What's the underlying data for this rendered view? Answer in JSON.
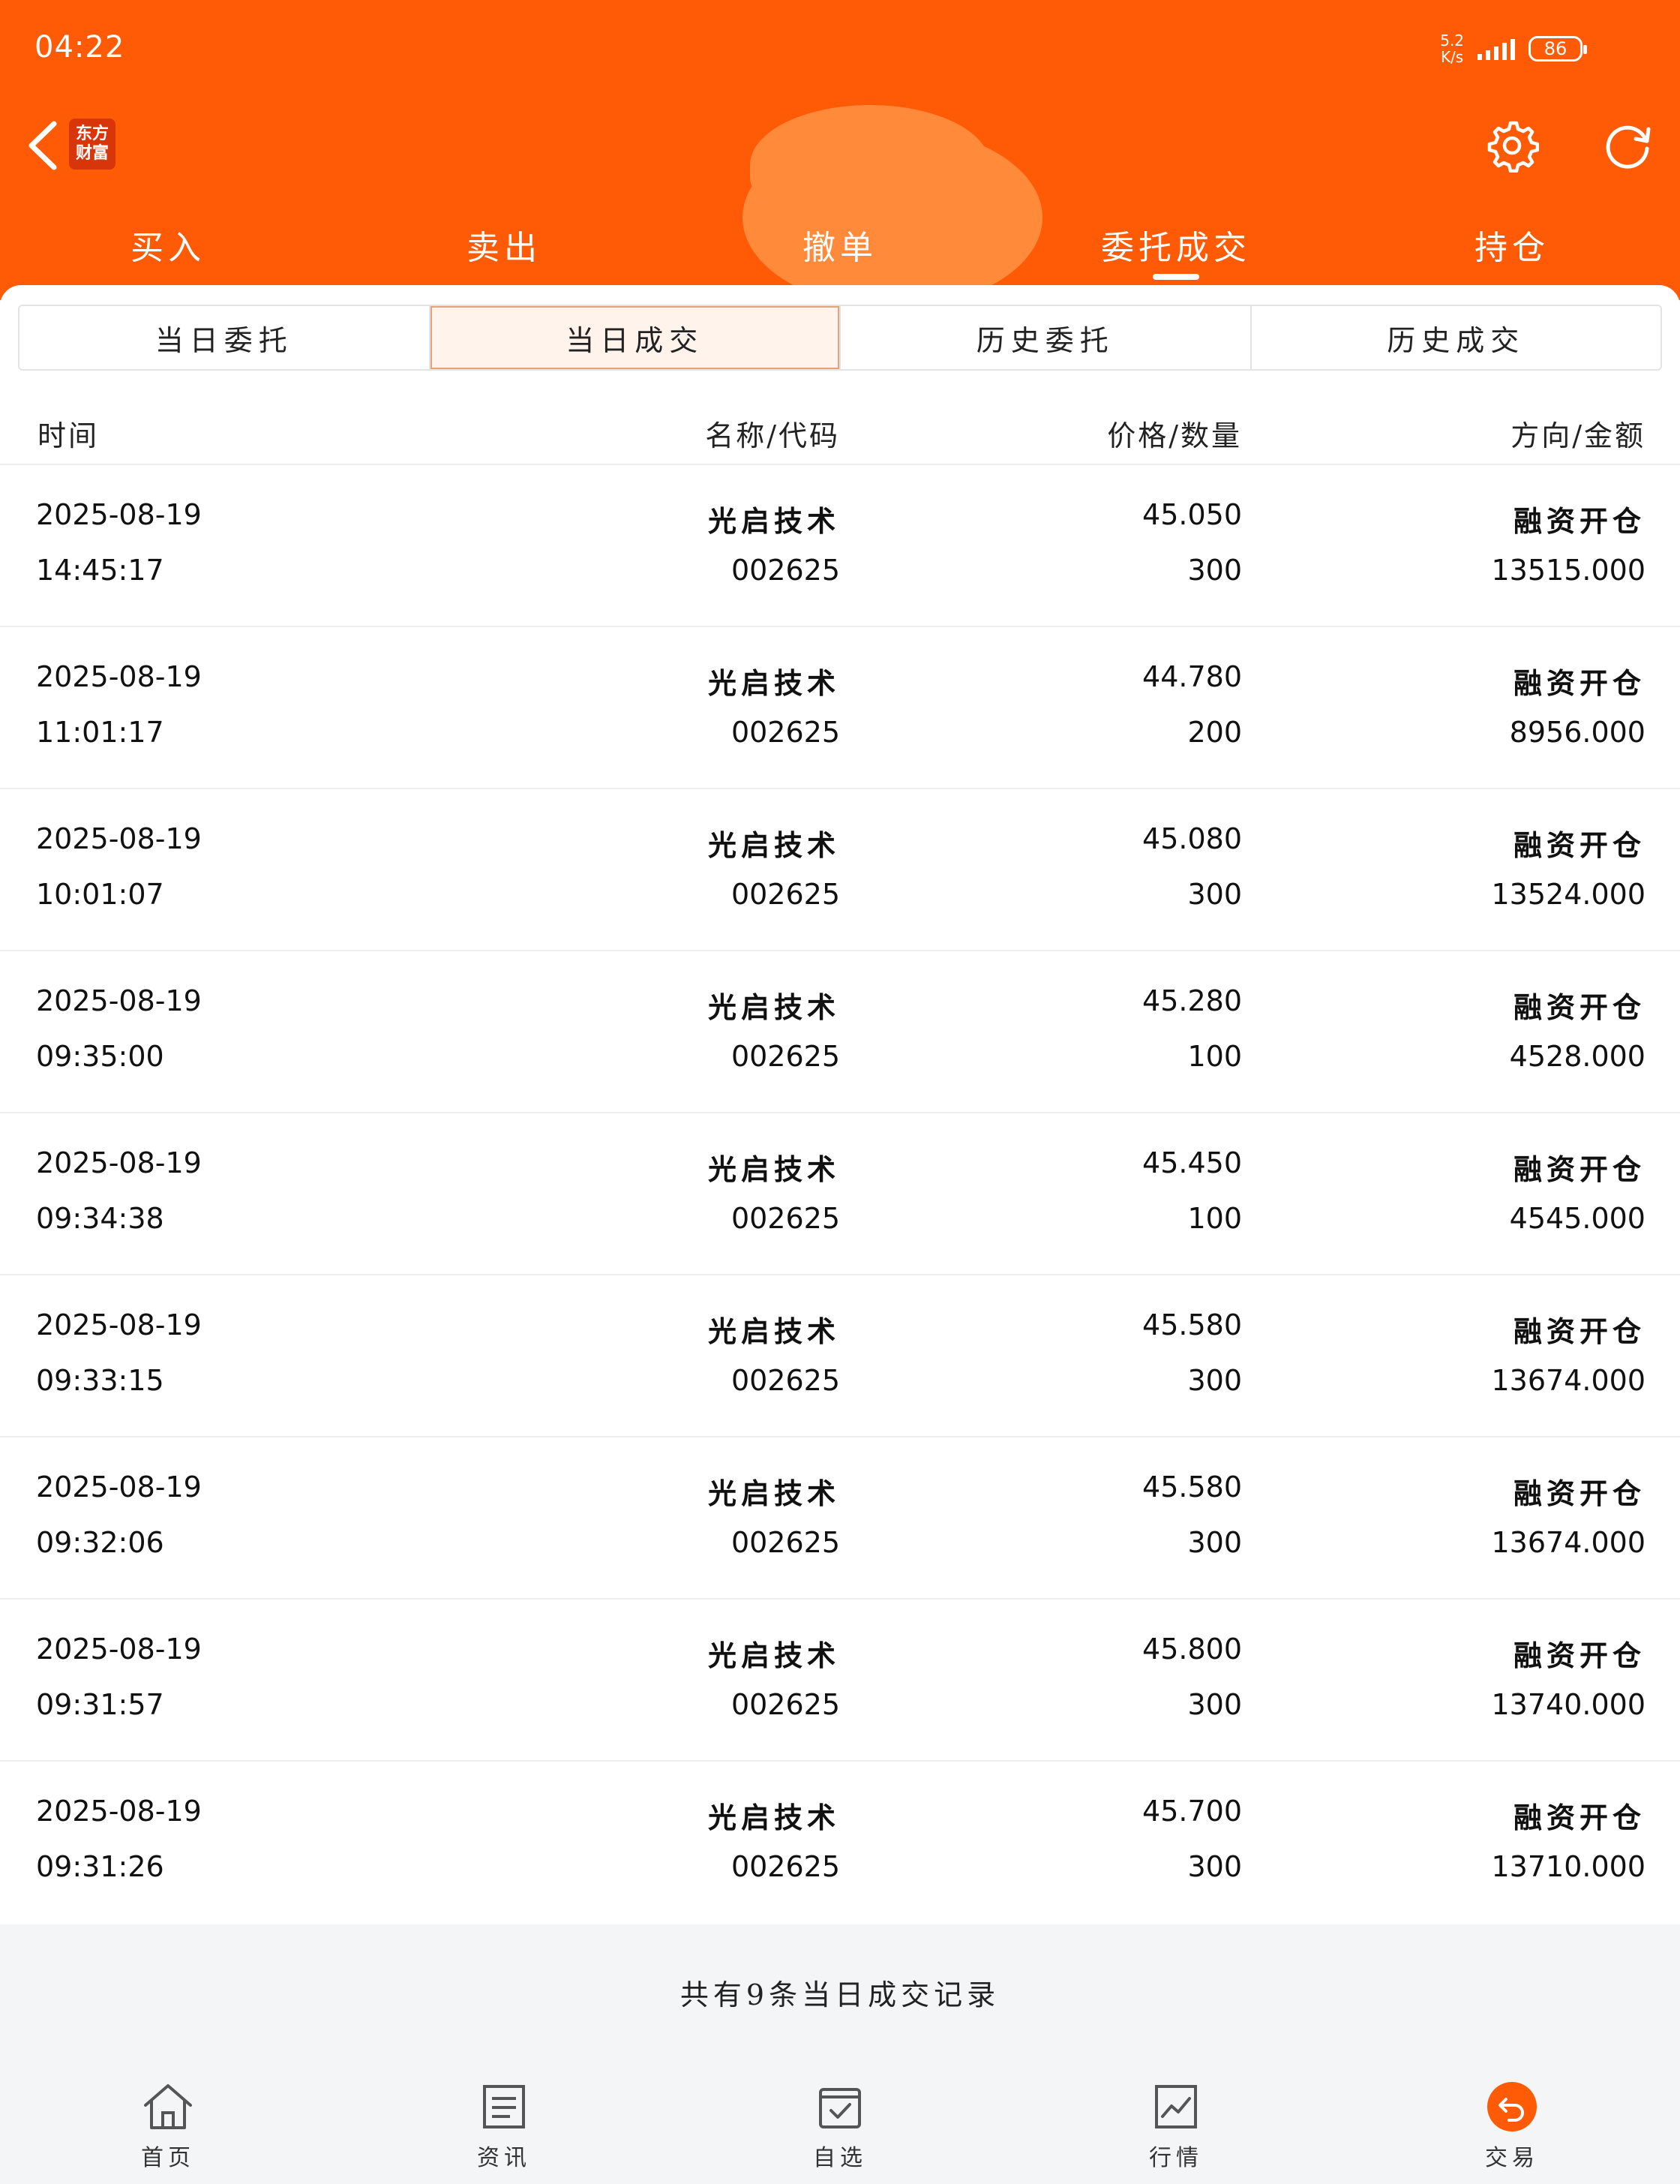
{
  "status_bar": {
    "time": "04:22",
    "net_speed_value": "5.2",
    "net_speed_unit": "K/s",
    "battery": "86"
  },
  "nav": {
    "logo_line1": "东方",
    "logo_line2": "财富"
  },
  "top_tabs": [
    {
      "label": "买入"
    },
    {
      "label": "卖出"
    },
    {
      "label": "撤单"
    },
    {
      "label": "委托成交"
    },
    {
      "label": "持仓"
    }
  ],
  "sub_tabs": [
    {
      "label": "当日委托"
    },
    {
      "label": "当日成交"
    },
    {
      "label": "历史委托"
    },
    {
      "label": "历史成交"
    }
  ],
  "table": {
    "headers": {
      "time": "时间",
      "name_code": "名称/代码",
      "price_qty": "价格/数量",
      "direction_amount": "方向/金额"
    },
    "rows": [
      {
        "date": "2025-08-19",
        "time": "14:45:17",
        "name": "光启技术",
        "code": "002625",
        "price": "45.050",
        "qty": "300",
        "direction": "融资开仓",
        "amount": "13515.000"
      },
      {
        "date": "2025-08-19",
        "time": "11:01:17",
        "name": "光启技术",
        "code": "002625",
        "price": "44.780",
        "qty": "200",
        "direction": "融资开仓",
        "amount": "8956.000"
      },
      {
        "date": "2025-08-19",
        "time": "10:01:07",
        "name": "光启技术",
        "code": "002625",
        "price": "45.080",
        "qty": "300",
        "direction": "融资开仓",
        "amount": "13524.000"
      },
      {
        "date": "2025-08-19",
        "time": "09:35:00",
        "name": "光启技术",
        "code": "002625",
        "price": "45.280",
        "qty": "100",
        "direction": "融资开仓",
        "amount": "4528.000"
      },
      {
        "date": "2025-08-19",
        "time": "09:34:38",
        "name": "光启技术",
        "code": "002625",
        "price": "45.450",
        "qty": "100",
        "direction": "融资开仓",
        "amount": "4545.000"
      },
      {
        "date": "2025-08-19",
        "time": "09:33:15",
        "name": "光启技术",
        "code": "002625",
        "price": "45.580",
        "qty": "300",
        "direction": "融资开仓",
        "amount": "13674.000"
      },
      {
        "date": "2025-08-19",
        "time": "09:32:06",
        "name": "光启技术",
        "code": "002625",
        "price": "45.580",
        "qty": "300",
        "direction": "融资开仓",
        "amount": "13674.000"
      },
      {
        "date": "2025-08-19",
        "time": "09:31:57",
        "name": "光启技术",
        "code": "002625",
        "price": "45.800",
        "qty": "300",
        "direction": "融资开仓",
        "amount": "13740.000"
      },
      {
        "date": "2025-08-19",
        "time": "09:31:26",
        "name": "光启技术",
        "code": "002625",
        "price": "45.700",
        "qty": "300",
        "direction": "融资开仓",
        "amount": "13710.000"
      }
    ]
  },
  "footer_note": "共有9条当日成交记录",
  "bottom_nav": [
    {
      "label": "首页",
      "icon": "home-icon"
    },
    {
      "label": "资讯",
      "icon": "news-icon"
    },
    {
      "label": "自选",
      "icon": "watchlist-icon"
    },
    {
      "label": "行情",
      "icon": "market-chart-icon"
    },
    {
      "label": "交易",
      "icon": "trade-icon"
    }
  ],
  "colors": {
    "brand_orange": "#ff5a05",
    "active_subtab_bg": "#fff3ec"
  }
}
